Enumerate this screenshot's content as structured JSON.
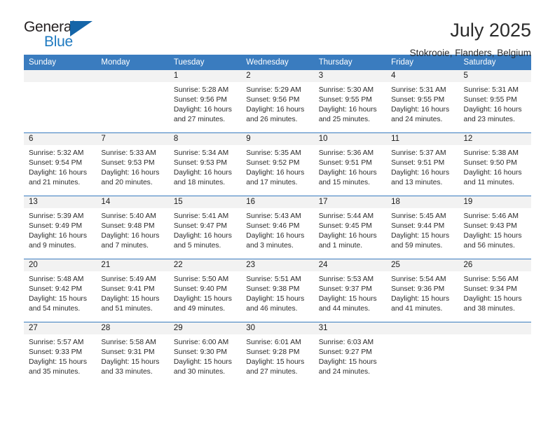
{
  "logo": {
    "word_one": "General",
    "word_two": "Blue",
    "triangle": "blue-triangle"
  },
  "header": {
    "month_title": "July 2025",
    "location": "Stokrooie, Flanders, Belgium"
  },
  "colors": {
    "header_blue": "#3a7cbf",
    "logo_blue": "#1f7ac0",
    "daynum_band": "#f2f2f2",
    "text": "#2b2b2b"
  },
  "labels": {
    "sunrise_prefix": "Sunrise:",
    "sunset_prefix": "Sunset:",
    "daylight_prefix": "Daylight:"
  },
  "weekdays": [
    "Sunday",
    "Monday",
    "Tuesday",
    "Wednesday",
    "Thursday",
    "Friday",
    "Saturday"
  ],
  "weeks": [
    [
      {
        "day": "",
        "sunrise": "",
        "sunset": "",
        "daylight_line1": "",
        "daylight_line2": ""
      },
      {
        "day": "",
        "sunrise": "",
        "sunset": "",
        "daylight_line1": "",
        "daylight_line2": ""
      },
      {
        "day": "1",
        "sunrise": "Sunrise: 5:28 AM",
        "sunset": "Sunset: 9:56 PM",
        "daylight_line1": "Daylight: 16 hours",
        "daylight_line2": "and 27 minutes."
      },
      {
        "day": "2",
        "sunrise": "Sunrise: 5:29 AM",
        "sunset": "Sunset: 9:56 PM",
        "daylight_line1": "Daylight: 16 hours",
        "daylight_line2": "and 26 minutes."
      },
      {
        "day": "3",
        "sunrise": "Sunrise: 5:30 AM",
        "sunset": "Sunset: 9:55 PM",
        "daylight_line1": "Daylight: 16 hours",
        "daylight_line2": "and 25 minutes."
      },
      {
        "day": "4",
        "sunrise": "Sunrise: 5:31 AM",
        "sunset": "Sunset: 9:55 PM",
        "daylight_line1": "Daylight: 16 hours",
        "daylight_line2": "and 24 minutes."
      },
      {
        "day": "5",
        "sunrise": "Sunrise: 5:31 AM",
        "sunset": "Sunset: 9:55 PM",
        "daylight_line1": "Daylight: 16 hours",
        "daylight_line2": "and 23 minutes."
      }
    ],
    [
      {
        "day": "6",
        "sunrise": "Sunrise: 5:32 AM",
        "sunset": "Sunset: 9:54 PM",
        "daylight_line1": "Daylight: 16 hours",
        "daylight_line2": "and 21 minutes."
      },
      {
        "day": "7",
        "sunrise": "Sunrise: 5:33 AM",
        "sunset": "Sunset: 9:53 PM",
        "daylight_line1": "Daylight: 16 hours",
        "daylight_line2": "and 20 minutes."
      },
      {
        "day": "8",
        "sunrise": "Sunrise: 5:34 AM",
        "sunset": "Sunset: 9:53 PM",
        "daylight_line1": "Daylight: 16 hours",
        "daylight_line2": "and 18 minutes."
      },
      {
        "day": "9",
        "sunrise": "Sunrise: 5:35 AM",
        "sunset": "Sunset: 9:52 PM",
        "daylight_line1": "Daylight: 16 hours",
        "daylight_line2": "and 17 minutes."
      },
      {
        "day": "10",
        "sunrise": "Sunrise: 5:36 AM",
        "sunset": "Sunset: 9:51 PM",
        "daylight_line1": "Daylight: 16 hours",
        "daylight_line2": "and 15 minutes."
      },
      {
        "day": "11",
        "sunrise": "Sunrise: 5:37 AM",
        "sunset": "Sunset: 9:51 PM",
        "daylight_line1": "Daylight: 16 hours",
        "daylight_line2": "and 13 minutes."
      },
      {
        "day": "12",
        "sunrise": "Sunrise: 5:38 AM",
        "sunset": "Sunset: 9:50 PM",
        "daylight_line1": "Daylight: 16 hours",
        "daylight_line2": "and 11 minutes."
      }
    ],
    [
      {
        "day": "13",
        "sunrise": "Sunrise: 5:39 AM",
        "sunset": "Sunset: 9:49 PM",
        "daylight_line1": "Daylight: 16 hours",
        "daylight_line2": "and 9 minutes."
      },
      {
        "day": "14",
        "sunrise": "Sunrise: 5:40 AM",
        "sunset": "Sunset: 9:48 PM",
        "daylight_line1": "Daylight: 16 hours",
        "daylight_line2": "and 7 minutes."
      },
      {
        "day": "15",
        "sunrise": "Sunrise: 5:41 AM",
        "sunset": "Sunset: 9:47 PM",
        "daylight_line1": "Daylight: 16 hours",
        "daylight_line2": "and 5 minutes."
      },
      {
        "day": "16",
        "sunrise": "Sunrise: 5:43 AM",
        "sunset": "Sunset: 9:46 PM",
        "daylight_line1": "Daylight: 16 hours",
        "daylight_line2": "and 3 minutes."
      },
      {
        "day": "17",
        "sunrise": "Sunrise: 5:44 AM",
        "sunset": "Sunset: 9:45 PM",
        "daylight_line1": "Daylight: 16 hours",
        "daylight_line2": "and 1 minute."
      },
      {
        "day": "18",
        "sunrise": "Sunrise: 5:45 AM",
        "sunset": "Sunset: 9:44 PM",
        "daylight_line1": "Daylight: 15 hours",
        "daylight_line2": "and 59 minutes."
      },
      {
        "day": "19",
        "sunrise": "Sunrise: 5:46 AM",
        "sunset": "Sunset: 9:43 PM",
        "daylight_line1": "Daylight: 15 hours",
        "daylight_line2": "and 56 minutes."
      }
    ],
    [
      {
        "day": "20",
        "sunrise": "Sunrise: 5:48 AM",
        "sunset": "Sunset: 9:42 PM",
        "daylight_line1": "Daylight: 15 hours",
        "daylight_line2": "and 54 minutes."
      },
      {
        "day": "21",
        "sunrise": "Sunrise: 5:49 AM",
        "sunset": "Sunset: 9:41 PM",
        "daylight_line1": "Daylight: 15 hours",
        "daylight_line2": "and 51 minutes."
      },
      {
        "day": "22",
        "sunrise": "Sunrise: 5:50 AM",
        "sunset": "Sunset: 9:40 PM",
        "daylight_line1": "Daylight: 15 hours",
        "daylight_line2": "and 49 minutes."
      },
      {
        "day": "23",
        "sunrise": "Sunrise: 5:51 AM",
        "sunset": "Sunset: 9:38 PM",
        "daylight_line1": "Daylight: 15 hours",
        "daylight_line2": "and 46 minutes."
      },
      {
        "day": "24",
        "sunrise": "Sunrise: 5:53 AM",
        "sunset": "Sunset: 9:37 PM",
        "daylight_line1": "Daylight: 15 hours",
        "daylight_line2": "and 44 minutes."
      },
      {
        "day": "25",
        "sunrise": "Sunrise: 5:54 AM",
        "sunset": "Sunset: 9:36 PM",
        "daylight_line1": "Daylight: 15 hours",
        "daylight_line2": "and 41 minutes."
      },
      {
        "day": "26",
        "sunrise": "Sunrise: 5:56 AM",
        "sunset": "Sunset: 9:34 PM",
        "daylight_line1": "Daylight: 15 hours",
        "daylight_line2": "and 38 minutes."
      }
    ],
    [
      {
        "day": "27",
        "sunrise": "Sunrise: 5:57 AM",
        "sunset": "Sunset: 9:33 PM",
        "daylight_line1": "Daylight: 15 hours",
        "daylight_line2": "and 35 minutes."
      },
      {
        "day": "28",
        "sunrise": "Sunrise: 5:58 AM",
        "sunset": "Sunset: 9:31 PM",
        "daylight_line1": "Daylight: 15 hours",
        "daylight_line2": "and 33 minutes."
      },
      {
        "day": "29",
        "sunrise": "Sunrise: 6:00 AM",
        "sunset": "Sunset: 9:30 PM",
        "daylight_line1": "Daylight: 15 hours",
        "daylight_line2": "and 30 minutes."
      },
      {
        "day": "30",
        "sunrise": "Sunrise: 6:01 AM",
        "sunset": "Sunset: 9:28 PM",
        "daylight_line1": "Daylight: 15 hours",
        "daylight_line2": "and 27 minutes."
      },
      {
        "day": "31",
        "sunrise": "Sunrise: 6:03 AM",
        "sunset": "Sunset: 9:27 PM",
        "daylight_line1": "Daylight: 15 hours",
        "daylight_line2": "and 24 minutes."
      },
      {
        "day": "",
        "sunrise": "",
        "sunset": "",
        "daylight_line1": "",
        "daylight_line2": ""
      },
      {
        "day": "",
        "sunrise": "",
        "sunset": "",
        "daylight_line1": "",
        "daylight_line2": ""
      }
    ]
  ]
}
